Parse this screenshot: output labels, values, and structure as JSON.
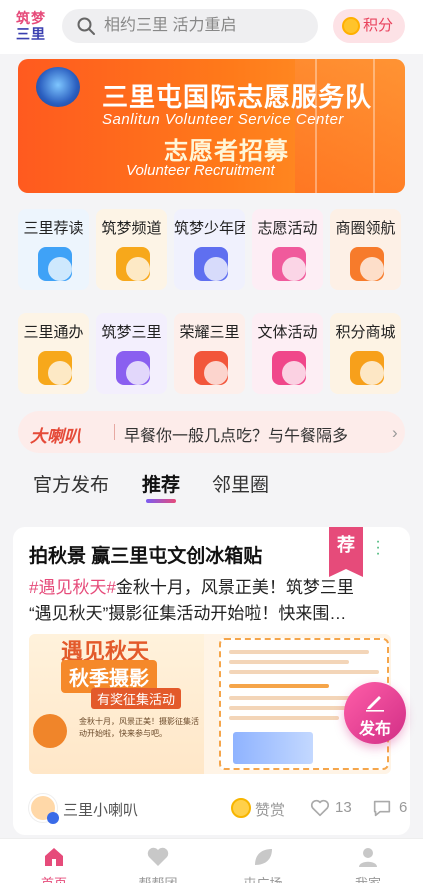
{
  "app": {
    "logo_text_top": "筑梦",
    "logo_text_bottom": "三里"
  },
  "header": {
    "search_placeholder": "相约三里 活力重启",
    "points_label": "积分"
  },
  "banner": {
    "title_cn": "三里屯国际志愿服务队",
    "title_en": "Sanlitun Volunteer Service Center",
    "subtitle_cn": "志愿者招募",
    "subtitle_en": "Volunteer Recruitment"
  },
  "grid": [
    {
      "label": "三里荐读",
      "icon": "document-icon",
      "color": "#3fa2f7",
      "bg": "#edf5fd"
    },
    {
      "label": "筑梦频道",
      "icon": "play-icon",
      "color": "#f7a81b",
      "bg": "#fdf4e6"
    },
    {
      "label": "筑梦少年团",
      "icon": "kid-face-icon",
      "color": "#5f6ff0",
      "bg": "#f0f1fd"
    },
    {
      "label": "志愿活动",
      "icon": "calendar-icon",
      "color": "#f05a9c",
      "bg": "#fdeef5"
    },
    {
      "label": "商圈领航",
      "icon": "building-icon",
      "color": "#f77b2b",
      "bg": "#fdf0e6"
    },
    {
      "label": "三里通办",
      "icon": "monitor-icon",
      "color": "#f7a81b",
      "bg": "#fdf4e6"
    },
    {
      "label": "筑梦三里",
      "icon": "link-share-icon",
      "color": "#8a5ff0",
      "bg": "#f3effd"
    },
    {
      "label": "荣耀三里",
      "icon": "honor-icon",
      "color": "#f2563b",
      "bg": "#fdefeb"
    },
    {
      "label": "文体活动",
      "icon": "star-icon",
      "color": "#f0478a",
      "bg": "#fdeef4"
    },
    {
      "label": "积分商城",
      "icon": "cart-icon",
      "color": "#f7a01b",
      "bg": "#fdf3e4"
    }
  ],
  "notice": {
    "tag": "大喇叭",
    "message": "早餐你一般几点吃？与午餐隔多"
  },
  "tabs": [
    {
      "label": "官方发布",
      "active": false
    },
    {
      "label": "推荐",
      "active": true
    },
    {
      "label": "邻里圈",
      "active": false
    }
  ],
  "post": {
    "title": "拍秋景 赢三里屯文创冰箱贴",
    "badge": "荐",
    "hashtag": "#遇见秋天#",
    "text_line1": "金秋十月，风景正美！筑梦三里",
    "text_line2": "“遇见秋天”摄影征集活动开始啦！快来围…",
    "poster": {
      "headline": "遇见秋天",
      "sub1": "秋季摄影",
      "sub2": "有奖征集活动",
      "blurb": "金秋十月，风景正美！摄影征集活动开始啦，快来参与吧。"
    },
    "author": "三里小喇叭",
    "reward_label": "赞赏",
    "likes": "13",
    "comments": "6"
  },
  "fab": {
    "label": "发布"
  },
  "tabbar": [
    {
      "label": "首页",
      "icon": "home-icon",
      "active": true
    },
    {
      "label": "帮帮团",
      "icon": "heart-hands-icon",
      "active": false
    },
    {
      "label": "屯广场",
      "icon": "leaf-icon",
      "active": false
    },
    {
      "label": "我家",
      "icon": "person-icon",
      "active": false
    }
  ],
  "colors": {
    "accent": "#e64b7a",
    "banner_orange": "#ff6a1f",
    "tab_indicator": "#7b5cf2"
  }
}
